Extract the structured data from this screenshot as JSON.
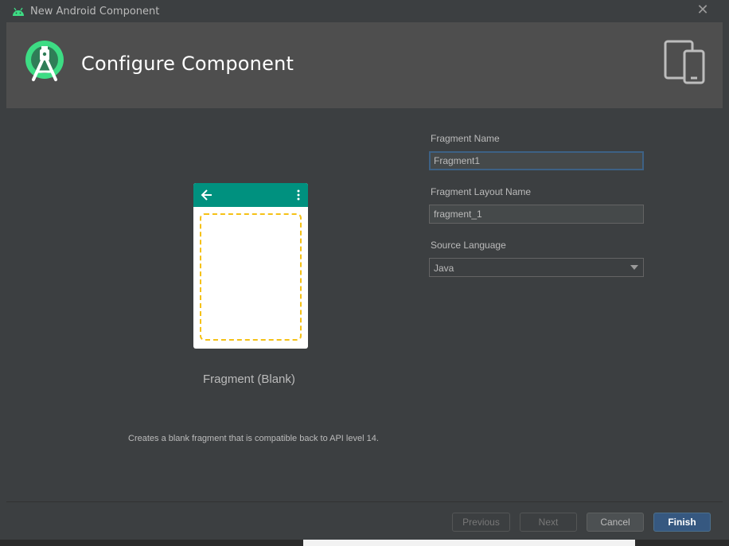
{
  "window": {
    "title": "New Android Component",
    "close_label": "✕"
  },
  "header": {
    "title": "Configure Component"
  },
  "template": {
    "name": "Fragment (Blank)",
    "description": "Creates a blank fragment that is compatible back to API level 14."
  },
  "form": {
    "fragment_name_label": "Fragment Name",
    "fragment_name_value": "Fragment1",
    "layout_name_label": "Fragment Layout Name",
    "layout_name_value": "fragment_1",
    "source_language_label": "Source Language",
    "source_language_value": "Java"
  },
  "buttons": {
    "previous": "Previous",
    "next": "Next",
    "cancel": "Cancel",
    "finish": "Finish"
  },
  "colors": {
    "dialog_bg": "#3c3f41",
    "header_bg": "#4e4e4e",
    "appbar_teal": "#00917f",
    "dashed_yellow": "#f5c116",
    "android_green": "#3ddc84",
    "primary_button": "#365880"
  },
  "icons": {
    "app": "android-icon",
    "header_logo": "android-studio-logo",
    "devices": "devices-icon",
    "back": "arrow-back-icon",
    "overflow": "more-vert-icon",
    "dropdown": "chevron-down-icon",
    "close": "close-icon"
  }
}
